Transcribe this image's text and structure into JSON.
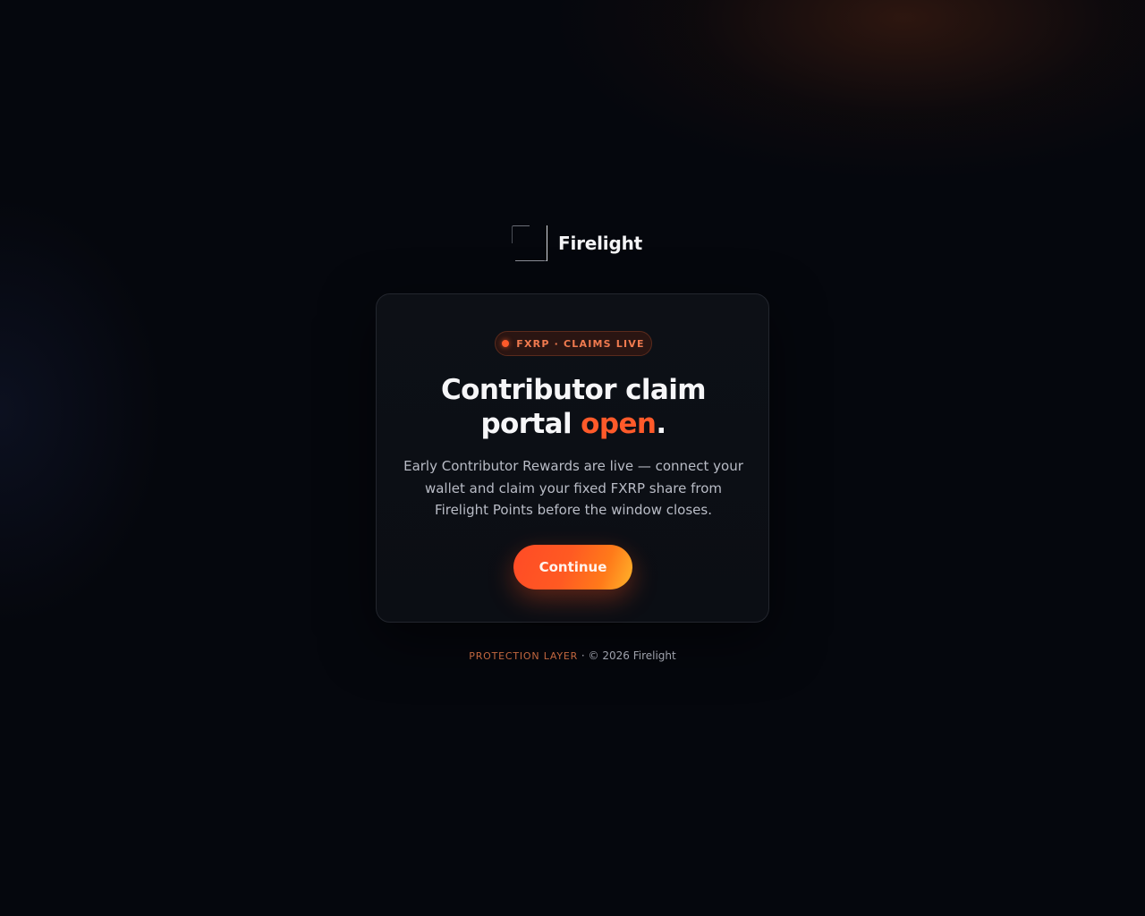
{
  "brand": {
    "name": "Firelight",
    "logo_icon": "bracket-square-icon"
  },
  "card": {
    "badge": {
      "text": "FXRP · CLAIMS LIVE",
      "dot_color": "#ff5a2a"
    },
    "title": {
      "line1": "Contributor claim",
      "line2_prefix": "portal ",
      "line2_accent": "open",
      "line2_suffix": "."
    },
    "description": "Early Contributor Rewards are live — connect your wallet and claim your fixed FXRP share from Firelight Points before the window closes.",
    "continue_label": "Continue"
  },
  "footer": {
    "tag": "PROTECTION LAYER",
    "separator": " · ",
    "copyright": "© 2026 Firelight"
  },
  "colors": {
    "accent": "#ff5a2a",
    "background": "#05070d",
    "card": "#0d1016"
  }
}
